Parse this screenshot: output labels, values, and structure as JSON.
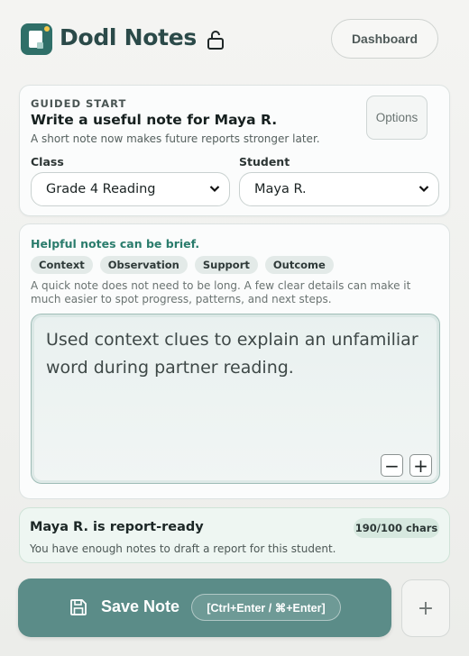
{
  "header": {
    "brand": "Dodl Notes",
    "lock_icon": "lock-open-icon",
    "dashboard_label": "Dashboard"
  },
  "guided": {
    "eyebrow": "GUIDED START",
    "title": "Write a useful note for Maya R.",
    "subtitle": "A short note now makes future reports stronger later.",
    "options_label": "Options",
    "class_label": "Class",
    "class_value": "Grade 4 Reading",
    "student_label": "Student",
    "student_value": "Maya R."
  },
  "notes": {
    "helpful": "Helpful notes can be brief.",
    "chips": [
      "Context",
      "Observation",
      "Support",
      "Outcome"
    ],
    "hint": "A quick note does not need to be long. A few clear details can make it much easier to spot progress, patterns, and next steps.",
    "note_text": "Used context clues to explain an unfamiliar word during partner reading.",
    "zoom_out": "−",
    "zoom_in": "+"
  },
  "ready": {
    "title": "Maya R. is report-ready",
    "subtitle": "You have enough notes to draft a report for this student.",
    "count_badge": "190/100 chars"
  },
  "actions": {
    "save_label": "Save Note",
    "shortcut": "[Ctrl+Enter / ⌘+Enter]",
    "add_label": "+"
  },
  "colors": {
    "accent": "#5b8c88",
    "brand": "#2f6f68",
    "helpful": "#2a7c6c"
  }
}
